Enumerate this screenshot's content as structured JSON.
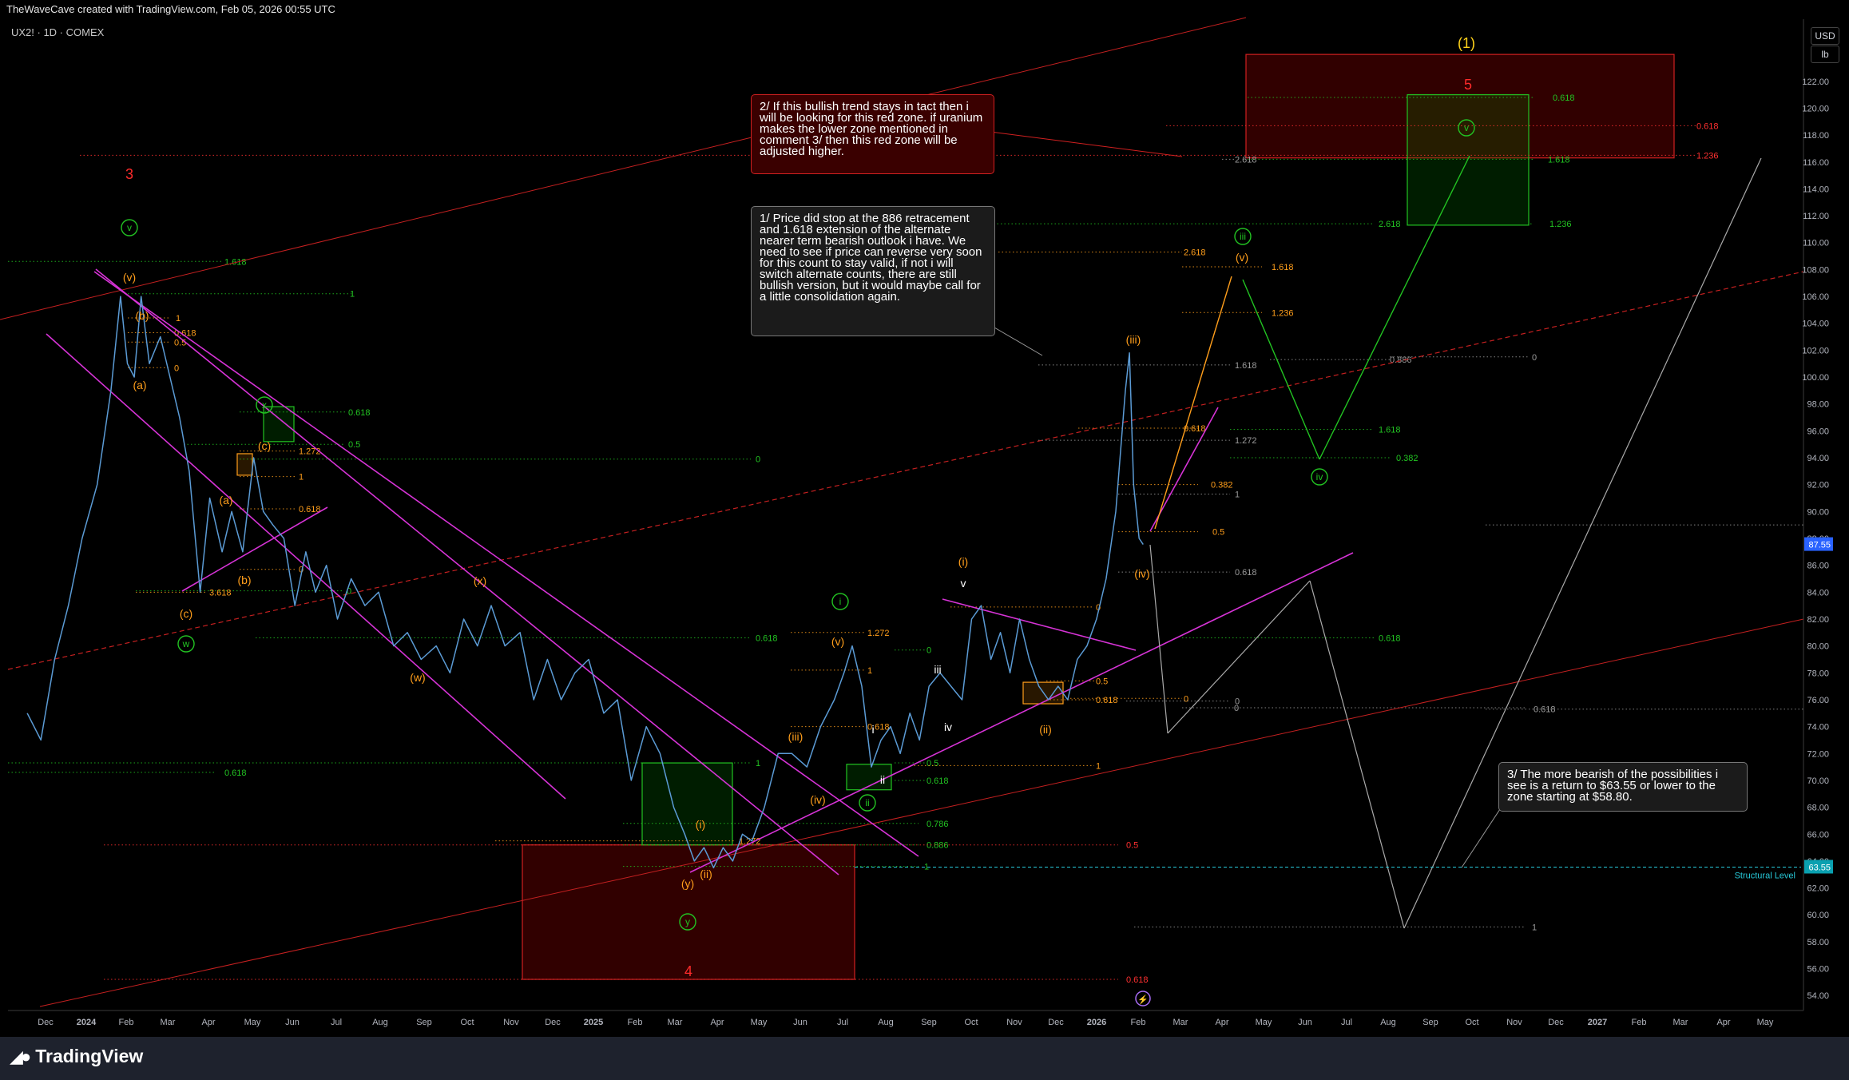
{
  "header": {
    "credit": "TheWaveCave created with TradingView.com, Feb 05, 2026 00:55 UTC",
    "symbol": "UX2! · 1D · COMEX"
  },
  "scale_buttons": {
    "currency": "USD",
    "unit": "lb"
  },
  "footer": {
    "brand": "TradingView"
  },
  "callouts": {
    "note1": "1/ Price did stop at the 886 retracement and 1.618 extension of the alternate nearer term bearish outlook i have. We need to see if price can reverse very soon for this count to stay valid, if not i will switch alternate counts, there are still bullish version, but it would maybe call for a little consolidation again.",
    "note2": "2/ If this bullish trend stays in tact then i will be looking for this red zone. if uranium makes the lower zone mentioned in comment 3/ then this red zone will be adjusted higher.",
    "note3": "3/ The more bearish of the possibilities i see is a return to $63.55 or lower to the zone starting at $58.80."
  },
  "colors": {
    "background": "#000000",
    "price_line": "#5b9bd5",
    "fib_green": "#22c322",
    "fib_orange": "#ff9e1b",
    "fib_red": "#ff3030",
    "trendline_magenta": "#d633d6",
    "structural_cyan": "#27c9d9",
    "last_price_badge": "#2962ff"
  },
  "chart_data": {
    "type": "line",
    "title": "UX2! · 1D · COMEX",
    "ylabel": "USD / lb",
    "ylim": [
      53,
      124
    ],
    "y_ticks": [
      54,
      56,
      58,
      60,
      62,
      64,
      66,
      68,
      70,
      72,
      74,
      76,
      78,
      80,
      82,
      84,
      86,
      88,
      90,
      92,
      94,
      96,
      98,
      100,
      102,
      104,
      106,
      108,
      110,
      112,
      114,
      116,
      118,
      120,
      122
    ],
    "x_ticks": [
      "Dec",
      "2024",
      "Feb",
      "Mar",
      "Apr",
      "May",
      "Jun",
      "Jul",
      "Aug",
      "Sep",
      "Oct",
      "Nov",
      "Dec",
      "2025",
      "Feb",
      "Mar",
      "Apr",
      "May",
      "Jun",
      "Jul",
      "Aug",
      "Sep",
      "Oct",
      "Nov",
      "Dec",
      "2026",
      "Feb",
      "Mar",
      "Apr",
      "May",
      "Jun",
      "Jul",
      "Aug",
      "Sep",
      "Oct",
      "Nov",
      "Dec",
      "2027",
      "Feb",
      "Mar",
      "Apr",
      "May"
    ],
    "last_price": 87.55,
    "structural_level": {
      "label": "Structural Level",
      "value": 63.55
    },
    "series": [
      {
        "x": [
          "2023-11-15",
          "2023-11-25",
          "2023-12-05",
          "2023-12-15",
          "2023-12-25",
          "2024-01-05",
          "2024-01-15",
          "2024-01-22",
          "2024-01-27",
          "2024-02-01",
          "2024-02-06",
          "2024-02-12",
          "2024-02-20",
          "2024-02-27",
          "2024-03-05",
          "2024-03-12",
          "2024-03-20",
          "2024-03-27",
          "2024-04-05",
          "2024-04-12",
          "2024-04-20",
          "2024-04-28",
          "2024-05-05",
          "2024-05-12",
          "2024-05-20",
          "2024-05-28",
          "2024-06-05",
          "2024-06-12",
          "2024-06-20",
          "2024-06-28",
          "2024-07-08",
          "2024-07-18",
          "2024-07-28",
          "2024-08-08",
          "2024-08-18",
          "2024-08-28",
          "2024-09-08",
          "2024-09-18",
          "2024-09-28",
          "2024-10-08",
          "2024-10-18",
          "2024-10-28",
          "2024-11-08",
          "2024-11-18",
          "2024-11-28",
          "2024-12-08",
          "2024-12-18",
          "2024-12-28",
          "2025-01-08",
          "2025-01-18",
          "2025-01-28",
          "2025-02-08",
          "2025-02-18",
          "2025-02-28",
          "2025-03-08",
          "2025-03-15",
          "2025-03-22",
          "2025-03-29",
          "2025-04-05",
          "2025-04-12",
          "2025-04-19",
          "2025-04-26",
          "2025-05-05",
          "2025-05-15",
          "2025-05-25",
          "2025-06-05",
          "2025-06-15",
          "2025-06-25",
          "2025-07-02",
          "2025-07-08",
          "2025-07-15",
          "2025-07-22",
          "2025-07-29",
          "2025-08-05",
          "2025-08-12",
          "2025-08-19",
          "2025-08-26",
          "2025-09-02",
          "2025-09-10",
          "2025-09-18",
          "2025-09-26",
          "2025-10-03",
          "2025-10-10",
          "2025-10-17",
          "2025-10-24",
          "2025-10-31",
          "2025-11-07",
          "2025-11-14",
          "2025-11-21",
          "2025-11-28",
          "2025-12-05",
          "2025-12-12",
          "2025-12-19",
          "2025-12-26",
          "2026-01-02",
          "2026-01-09",
          "2026-01-16",
          "2026-01-23",
          "2026-01-26",
          "2026-01-29",
          "2026-02-02",
          "2026-02-05"
        ],
        "y": [
          75,
          73,
          79,
          83,
          88,
          92,
          99,
          106,
          101,
          100,
          106,
          101,
          103,
          100,
          97,
          93,
          84,
          91,
          87,
          90,
          87,
          94,
          90,
          89,
          88,
          83,
          87,
          84,
          86,
          82,
          85,
          83,
          84,
          80,
          81,
          79,
          80,
          78,
          82,
          80,
          83,
          80,
          81,
          76,
          79,
          76,
          78,
          79,
          75,
          76,
          70,
          74,
          72,
          68,
          66,
          64,
          65,
          63.5,
          65,
          64,
          66,
          65.5,
          68,
          72,
          72,
          71,
          74,
          76,
          78,
          80,
          77,
          71,
          73,
          74,
          72,
          75,
          73,
          77,
          78,
          77,
          76,
          82,
          83,
          79,
          81,
          78,
          82,
          79,
          77,
          76,
          77,
          76,
          79,
          80,
          82,
          85,
          90,
          99,
          101.8,
          92,
          88,
          87.55
        ]
      }
    ],
    "zones": [
      {
        "color": "red",
        "label": "4",
        "y0": 55.2,
        "y1": 65.2
      },
      {
        "color": "red",
        "label": "5",
        "y0": 116.3,
        "y1": 124
      },
      {
        "color": "green",
        "label": "(i)",
        "y0": 65.2,
        "y1": 71.3
      },
      {
        "color": "green",
        "label": "x",
        "y0": 95.2,
        "y1": 97.8
      },
      {
        "color": "green",
        "label": "v",
        "y0": 111.3,
        "y1": 121
      },
      {
        "color": "green",
        "label": "ii",
        "y0": 69.3,
        "y1": 71.2
      },
      {
        "color": "orange",
        "label": "(c)",
        "y0": 92.7,
        "y1": 94.3
      },
      {
        "color": "orange",
        "label": "(ii)",
        "y0": 75.7,
        "y1": 77.3
      }
    ],
    "wave_labels": [
      "(1)",
      "5",
      "3",
      "4",
      "v",
      "(v)",
      "(b)",
      "(a)",
      "x",
      "(c)",
      "(a)",
      "(b)",
      "(c)",
      "w",
      "(x)",
      "(w)",
      "(i)",
      "(ii)",
      "(y)",
      "y",
      "(iii)",
      "(iv)",
      "(v)",
      "i",
      "ii",
      "iii",
      "iv",
      "i",
      "v",
      "(i)",
      "(ii)",
      "(iii)",
      "(iv)",
      "(v)",
      "iii",
      "iv",
      "v"
    ],
    "fib_levels": [
      "1.618",
      "1",
      "0.618",
      "0.5",
      "0",
      "1.272",
      "3.618",
      "0.786",
      "0.886",
      "2.618",
      "1.236",
      "0.382",
      "0.886",
      "1.618"
    ]
  }
}
